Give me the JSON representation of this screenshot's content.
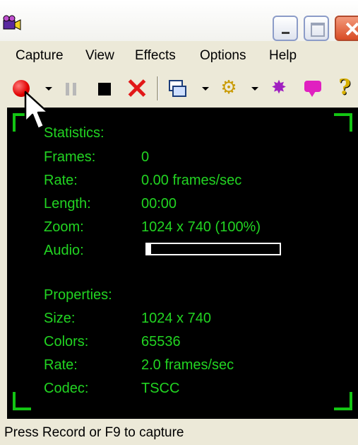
{
  "window": {
    "icon": "camera-app-icon"
  },
  "menu": [
    {
      "label": "Capture"
    },
    {
      "label": "View"
    },
    {
      "label": "Effects"
    },
    {
      "label": "Options"
    },
    {
      "label": "Help"
    }
  ],
  "toolbar": {
    "icons": [
      "record-icon",
      "dropdown-icon",
      "pause-icon",
      "stop-icon",
      "delete-icon",
      "select-region-icon",
      "dropdown-icon",
      "settings-icon",
      "dropdown-icon",
      "effects-icon",
      "annotation-icon",
      "help-icon"
    ],
    "record_color": "#e00000"
  },
  "statistics": {
    "heading": "Statistics:",
    "rows": [
      {
        "label": "Frames:",
        "value": "0"
      },
      {
        "label": "Rate:",
        "value": "0.00 frames/sec"
      },
      {
        "label": "Length:",
        "value": "00:00"
      },
      {
        "label": "Zoom:",
        "value": "1024 x 740 (100%)"
      },
      {
        "label": "Audio:",
        "value": ""
      }
    ],
    "audio_level": 0.03
  },
  "properties": {
    "heading": "Properties:",
    "rows": [
      {
        "label": "Size:",
        "value": "1024 x 740"
      },
      {
        "label": "Colors:",
        "value": "65536"
      },
      {
        "label": "Rate:",
        "value": "2.0 frames/sec"
      },
      {
        "label": "Codec:",
        "value": "TSCC"
      }
    ]
  },
  "status": {
    "text": "Press Record or  F9 to capture"
  },
  "colors": {
    "display_text": "#22d422",
    "display_bg": "#000000",
    "window_bg": "#ece9d8"
  }
}
